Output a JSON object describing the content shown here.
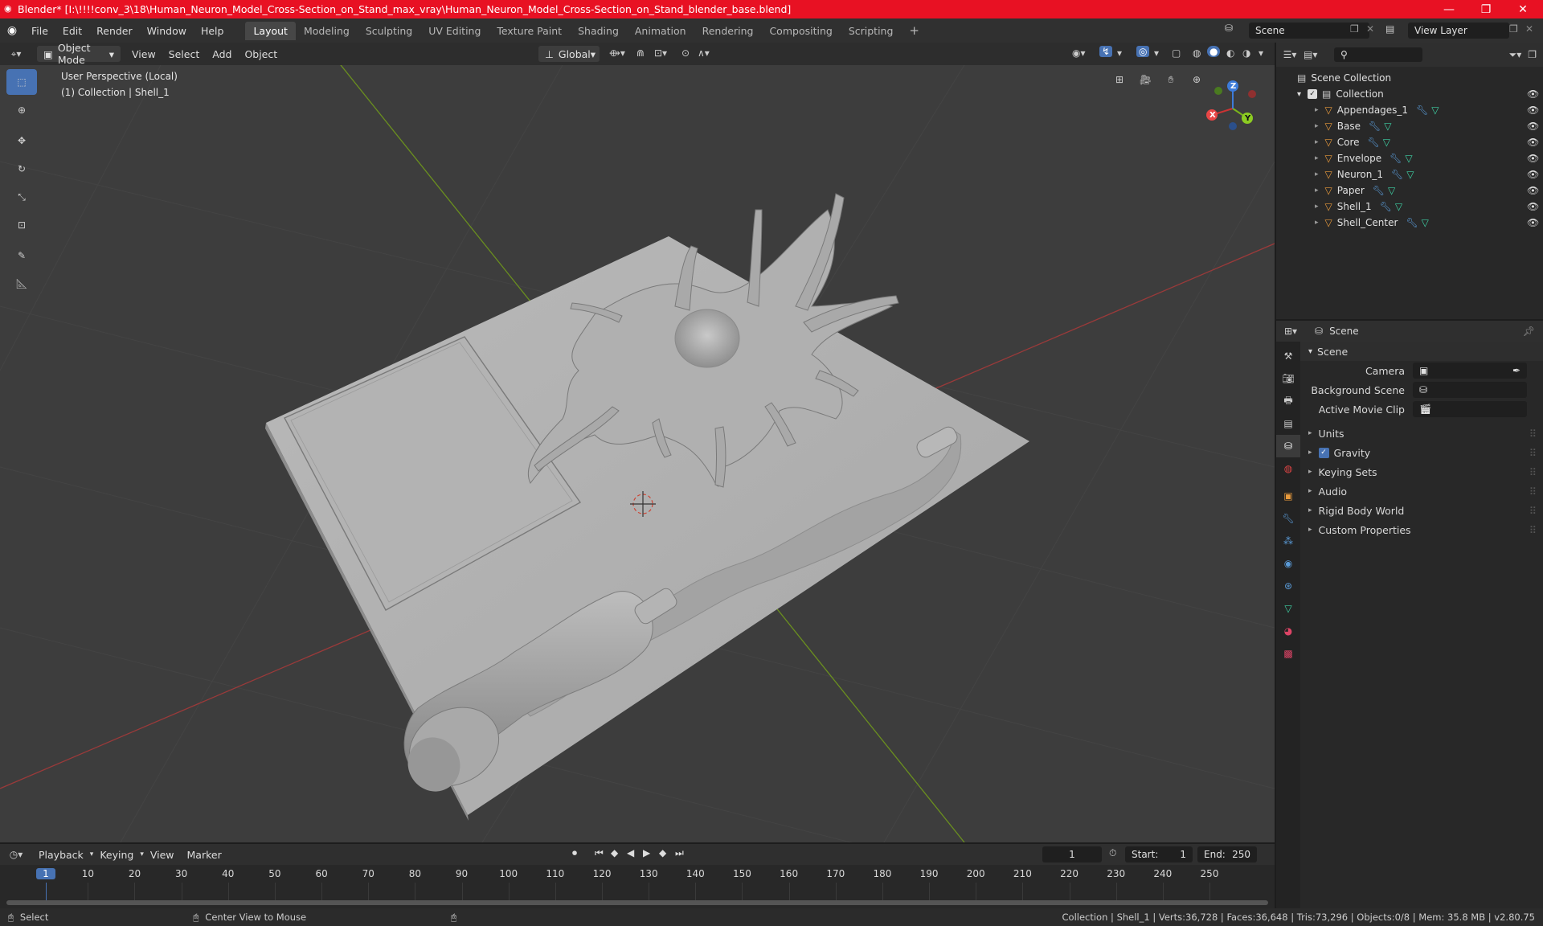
{
  "window": {
    "title": "Blender* [I:\\!!!!conv_3\\18\\Human_Neuron_Model_Cross-Section_on_Stand_max_vray\\Human_Neuron_Model_Cross-Section_on_Stand_blender_base.blend]",
    "minimize": "—",
    "maximize": "❐",
    "close": "✕"
  },
  "menu": [
    "File",
    "Edit",
    "Render",
    "Window",
    "Help"
  ],
  "workspaces": [
    "Layout",
    "Modeling",
    "Sculpting",
    "UV Editing",
    "Texture Paint",
    "Shading",
    "Animation",
    "Rendering",
    "Compositing",
    "Scripting"
  ],
  "workspace_add": "+",
  "scene_field": "Scene",
  "view_layer_field": "View Layer",
  "viewport_header": {
    "mode": "Object Mode",
    "menus": [
      "View",
      "Select",
      "Add",
      "Object"
    ],
    "orientation": "Global"
  },
  "viewport": {
    "perspective": "User Perspective (Local)",
    "context": "(1) Collection | Shell_1",
    "gizmo": {
      "x": "X",
      "y": "Y",
      "z": "Z"
    }
  },
  "outliner": {
    "search_placeholder": "",
    "root": "Scene Collection",
    "collection": "Collection",
    "items": [
      {
        "name": "Appendages_1"
      },
      {
        "name": "Base"
      },
      {
        "name": "Core"
      },
      {
        "name": "Envelope"
      },
      {
        "name": "Neuron_1"
      },
      {
        "name": "Paper"
      },
      {
        "name": "Shell_1"
      },
      {
        "name": "Shell_Center"
      }
    ]
  },
  "properties": {
    "header": "Scene",
    "panel": "Scene",
    "camera_label": "Camera",
    "background_label": "Background Scene",
    "movieclip_label": "Active Movie Clip",
    "sections": [
      "Units",
      "Gravity",
      "Keying Sets",
      "Audio",
      "Rigid Body World",
      "Custom Properties"
    ]
  },
  "timeline": {
    "menus": [
      "Playback",
      "Keying",
      "View",
      "Marker"
    ],
    "current_frame": "1",
    "start_label": "Start:",
    "start": "1",
    "end_label": "End:",
    "end": "250",
    "ruler": [
      "1",
      "10",
      "20",
      "30",
      "40",
      "50",
      "60",
      "70",
      "80",
      "90",
      "100",
      "110",
      "120",
      "130",
      "140",
      "150",
      "160",
      "170",
      "180",
      "190",
      "200",
      "210",
      "220",
      "230",
      "240",
      "250"
    ]
  },
  "status": {
    "left": "Select",
    "middle": "Center View to Mouse",
    "right": "Collection | Shell_1 | Verts:36,728 | Faces:36,648 | Tris:73,296 | Objects:0/8 | Mem: 35.8 MB | v2.80.75"
  },
  "colors": {
    "accent": "#4772b3",
    "titlebar": "#e81123",
    "object_orange": "#e89a3c",
    "mesh_green": "#3fd2a5"
  }
}
